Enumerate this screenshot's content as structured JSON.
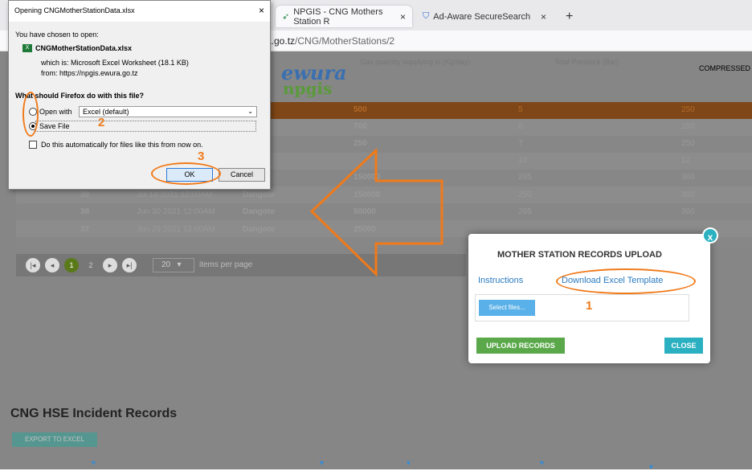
{
  "browser": {
    "tabs": [
      {
        "label": "NPGIS - CNG Mothers Station R",
        "close": "×"
      },
      {
        "label": "Ad-Aware SecureSearch",
        "close": "×"
      }
    ],
    "new_tab": "+",
    "url_domain": "a.go.tz",
    "url_path": "/CNG/MotherStations/2"
  },
  "page": {
    "logo_top": "ewura",
    "logo_bottom": "npgis",
    "header_col1": "Gas quantity supplying in (Kg/day)",
    "header_col2": "Total Pressure (Bar)",
    "header_col3": "COMPRESSED",
    "rows": [
      {
        "id": "39",
        "date": "Jul 14 2021 12:00AM",
        "owner": "Dangote",
        "qty": "150000",
        "pressure": "250",
        "val": "360"
      },
      {
        "id": "38",
        "date": "Jun 30 2021 12:00AM",
        "owner": "Dangote",
        "qty": "50000",
        "pressure": "295",
        "val": "360"
      },
      {
        "id": "37",
        "date": "Jun 29 2021 12:00AM",
        "owner": "Dangote",
        "qty": "25000",
        "pressure": "",
        "val": ""
      }
    ],
    "partial_rows": [
      {
        "qty": "500",
        "pressure": "5",
        "val": "250"
      },
      {
        "qty": "700",
        "pressure": "6",
        "val": "250"
      },
      {
        "qty": "250",
        "pressure": "7",
        "val": "250"
      },
      {
        "qty": "",
        "pressure": "10",
        "val": "12"
      },
      {
        "qty": "150000",
        "pressure": "295",
        "val": "360"
      }
    ],
    "pager": {
      "page1": "1",
      "page2": "2",
      "page_size": "20",
      "items_label": "items per page"
    },
    "hse_title": "CNG HSE Incident Records",
    "export_label": "EXPORT TO EXCEL"
  },
  "dialog": {
    "title": "Opening CNGMotherStationData.xlsx",
    "close": "×",
    "chosen_label": "You have chosen to open:",
    "filename": "CNGMotherStationData.xlsx",
    "which_is": "which is:  Microsoft Excel Worksheet (18.1 KB)",
    "from": "from:  https://npgis.ewura.go.tz",
    "question": "What should Firefox do with this file?",
    "open_with_label": "Open with",
    "open_with_value": "Excel (default)",
    "save_file_label": "Save File",
    "auto_label": "Do this automatically for files like this from now on.",
    "ok": "OK",
    "cancel": "Cancel"
  },
  "modal": {
    "close_x": "x",
    "title": "MOTHER STATION RECORDS UPLOAD",
    "instructions": "Instructions",
    "download_template": "Download Excel Template",
    "select_files": "Select files...",
    "upload_records": "UPLOAD RECORDS",
    "close": "CLOSE"
  },
  "annotations": {
    "n1": "1",
    "n2": "2",
    "n3": "3",
    "orange": "#f07a1a"
  }
}
